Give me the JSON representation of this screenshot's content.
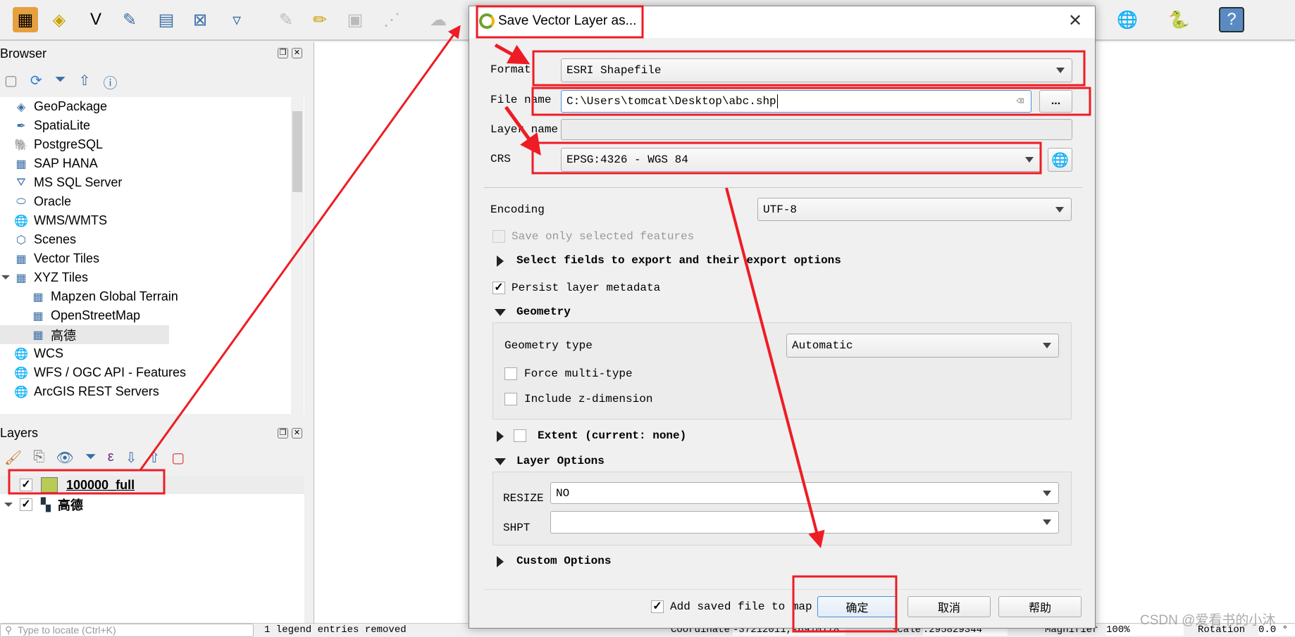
{
  "toolbar": {
    "icons": [
      "new-geopackage-layer-icon",
      "new-spatialite-layer-icon",
      "new-shapefile-layer-icon",
      "new-temporary-layer-icon",
      "new-virtual-layer-icon",
      "new-mesh-layer-icon",
      "new-gps-layer-icon",
      "current-edits-icon",
      "toggle-editing-icon",
      "save-edits-icon",
      "digitize-icon",
      "add-polygon-icon",
      "metasearch-icon",
      "python-console-icon",
      "help-icon"
    ]
  },
  "browser": {
    "title": "Browser",
    "items": [
      {
        "label": "GeoPackage",
        "icon": "geopackage-icon"
      },
      {
        "label": "SpatiaLite",
        "icon": "spatialite-icon"
      },
      {
        "label": "PostgreSQL",
        "icon": "postgresql-icon"
      },
      {
        "label": "SAP HANA",
        "icon": "sap-hana-icon"
      },
      {
        "label": "MS SQL Server",
        "icon": "mssql-icon"
      },
      {
        "label": "Oracle",
        "icon": "oracle-icon"
      },
      {
        "label": "WMS/WMTS",
        "icon": "wms-icon"
      },
      {
        "label": "Scenes",
        "icon": "scenes-icon"
      },
      {
        "label": "Vector Tiles",
        "icon": "vector-tiles-icon"
      },
      {
        "label": "XYZ Tiles",
        "icon": "xyz-tiles-icon",
        "expanded": true
      },
      {
        "label": "Mapzen Global Terrain",
        "icon": "xyz-tiles-icon",
        "child": true
      },
      {
        "label": "OpenStreetMap",
        "icon": "xyz-tiles-icon",
        "child": true
      },
      {
        "label": "高德",
        "icon": "xyz-tiles-icon",
        "child": true,
        "selected": true
      },
      {
        "label": "WCS",
        "icon": "wcs-icon"
      },
      {
        "label": "WFS / OGC API - Features",
        "icon": "wfs-icon"
      },
      {
        "label": "ArcGIS REST Servers",
        "icon": "arcgis-icon"
      }
    ]
  },
  "layers": {
    "title": "Layers",
    "items": [
      {
        "label": "100000_full",
        "checked": true,
        "color": "#b8cc55"
      },
      {
        "label": "高德",
        "checked": true
      }
    ]
  },
  "dialog": {
    "title": "Save Vector Layer as...",
    "format_label": "Format",
    "format_value": "ESRI Shapefile",
    "filename_label": "File name",
    "filename_value": "C:\\Users\\tomcat\\Desktop\\abc.shp",
    "browse_label": "...",
    "layername_label": "Layer name",
    "layername_value": "",
    "crs_label": "CRS",
    "crs_value": "EPSG:4326 - WGS 84",
    "encoding_label": "Encoding",
    "encoding_value": "UTF-8",
    "save_selected_label": "Save only selected features",
    "save_selected_checked": false,
    "select_fields_label": "Select fields to export and their export options",
    "persist_label": "Persist layer metadata",
    "persist_checked": true,
    "geometry_label": "Geometry",
    "geometry_type_label": "Geometry type",
    "geometry_type_value": "Automatic",
    "force_multi_label": "Force multi-type",
    "force_multi_checked": false,
    "include_z_label": "Include z-dimension",
    "include_z_checked": false,
    "extent_label": "Extent (current: none)",
    "layer_options_label": "Layer Options",
    "resize_label": "RESIZE",
    "resize_value": "NO",
    "shpt_label": "SHPT",
    "shpt_value": "",
    "custom_options_label": "Custom Options",
    "add_saved_label": "Add saved file to map",
    "add_saved_checked": true,
    "ok_label": "确定",
    "cancel_label": "取消",
    "help_label": "帮助"
  },
  "status": {
    "locate_placeholder": "Type to locate (Ctrl+K)",
    "message": "1 legend entries removed",
    "coordinate_label": "Coordinate",
    "coordinate_value": "-37212011,-6910178",
    "scale_label": "Scale",
    "scale_value": ":295829344",
    "magnifier_label": "Magnifier",
    "magnifier_value": "100%",
    "rotation_label": "Rotation",
    "rotation_value": "0.0 °"
  },
  "watermark": "CSDN @爱看书的小沐",
  "annotation_color": "#ee1c25"
}
